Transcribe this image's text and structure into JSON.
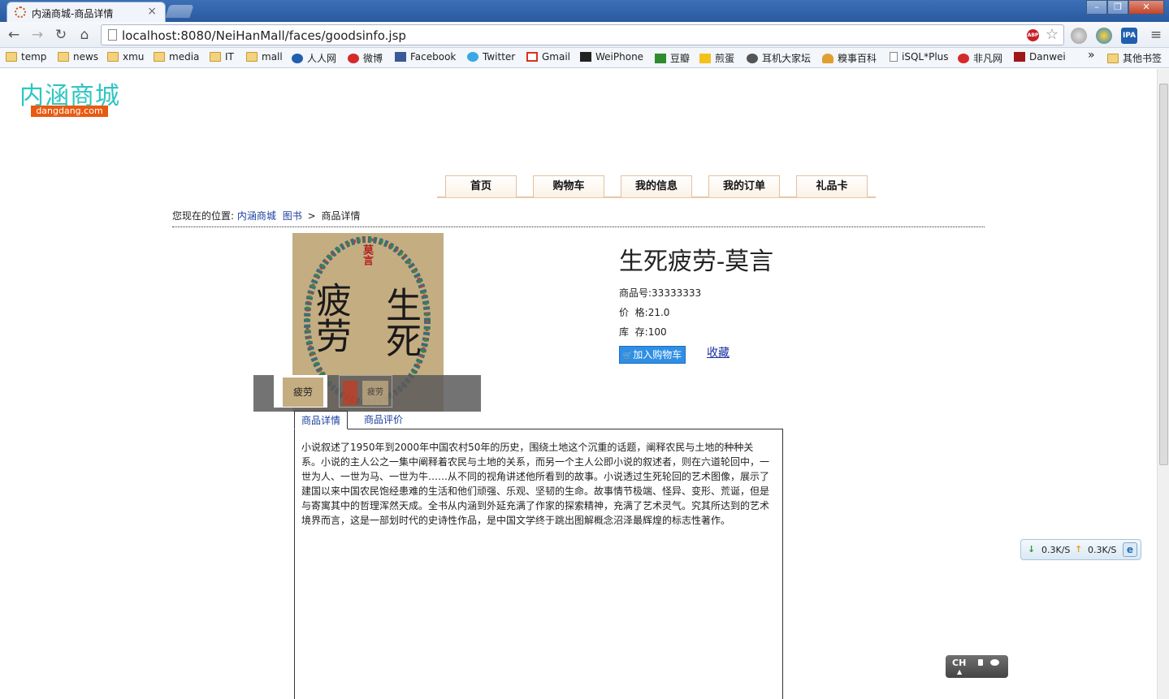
{
  "browser": {
    "tab_title": "内涵商城-商品详情",
    "url": "localhost:8080/NeiHanMall/faces/goodsinfo.jsp",
    "bookmarks": [
      "temp",
      "news",
      "xmu",
      "media",
      "IT",
      "mall",
      "人人网",
      "微博",
      "Facebook",
      "Twitter",
      "Gmail",
      "WeiPhone",
      "豆瓣",
      "煎蛋",
      "耳机大家坛",
      "糗事百科",
      "iSQL*Plus",
      "非凡网",
      "Danwei"
    ],
    "other_bookmarks": "其他书签",
    "overflow": "»",
    "abp": "ABP",
    "ipa": "IPA"
  },
  "site": {
    "logo": "内涵商城",
    "logo_sub": "dangdang.com",
    "nav": [
      "首页",
      "购物车",
      "我的信息",
      "我的订单",
      "礼品卡"
    ]
  },
  "breadcrumb": {
    "prefix": "您现在的位置:",
    "home": "内涵商城",
    "category": "图书",
    "separator": ">",
    "current": "商品详情"
  },
  "product": {
    "title": "生死疲劳-莫言",
    "sku_label": "商品号:",
    "sku": "33333333",
    "price_label": "价  格:",
    "price": "21.0",
    "stock_label": "库  存:",
    "stock": "100",
    "add_to_cart": "加入购物车",
    "favorite": "收藏",
    "cover_text": "莫言",
    "cover_title_1": "生死",
    "cover_title_2": "疲劳"
  },
  "detail": {
    "tabs": [
      "商品详情",
      "商品评价"
    ],
    "text": "小说叙述了1950年到2000年中国农村50年的历史，围绕土地这个沉重的话题，阐释农民与土地的种种关系。小说的主人公之一集中阐释着农民与土地的关系，而另一个主人公即小说的叙述者，则在六道轮回中，一世为人、一世为马、一世为牛……从不同的视角讲述他所看到的故事。小说透过生死轮回的艺术图像，展示了建国以来中国农民饱经患难的生活和他们顽强、乐观、坚韧的生命。故事情节极端、怪异、变形、荒诞，但是与寄寓其中的哲理浑然天成。全书从内涵到外延充满了作家的探索精神，充满了艺术灵气。究其所达到的艺术境界而言，这是一部划时代的史诗性作品，是中国文学终于跳出图解概念沼泽最辉煌的标志性著作。"
  },
  "widgets": {
    "down_speed": "0.3K/S",
    "up_speed": "0.3K/S",
    "ime": "CH"
  }
}
